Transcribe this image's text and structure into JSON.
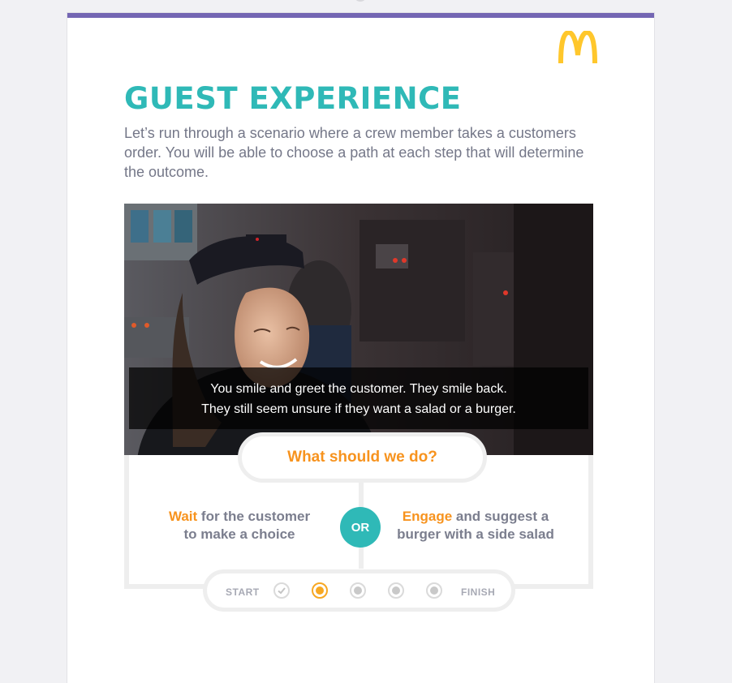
{
  "page": {
    "title": "GUEST EXPERIENCE",
    "intro": "Let’s run through a scenario where a crew member takes a customers order. You will be able to choose a path at each step that will determine the outcome."
  },
  "brand": {
    "accent": "#2fb9b7",
    "highlight": "#f7931e",
    "header_bar": "#7466b3",
    "logo_color": "#ffc72c"
  },
  "video": {
    "caption_line1": "You smile and greet the customer. They smile back.",
    "caption_line2": "They still seem unsure if they want a salad or a burger."
  },
  "question": "What should we do?",
  "choices": {
    "wait": {
      "keyword": "Wait",
      "rest_line1": " for the customer",
      "line2": "to make a choice"
    },
    "or_label": "OR",
    "engage": {
      "keyword": "Engage",
      "rest_line1": " and suggest a",
      "line2": "burger with a side salad"
    }
  },
  "progress": {
    "start_label": "START",
    "finish_label": "FINISH",
    "steps": [
      "completed",
      "current",
      "upcoming",
      "upcoming",
      "upcoming"
    ]
  },
  "icons": {
    "logo": "golden-arches-logo",
    "check": "check-icon"
  }
}
